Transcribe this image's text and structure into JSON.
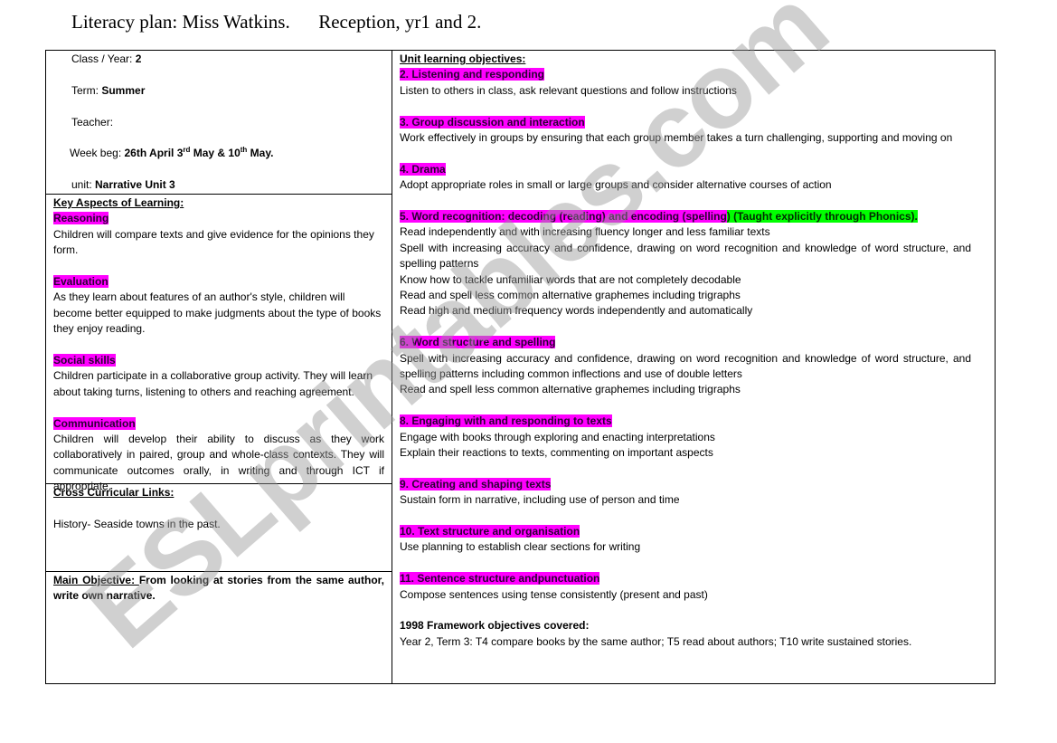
{
  "document": {
    "title": "Literacy plan: Miss Watkins.      Reception, yr1 and 2.",
    "watermark": "ESLprintables.com"
  },
  "header_info": {
    "class_year_label": "Class / Year: ",
    "class_year_value": "2",
    "term_label": "Term: ",
    "term_value": "Summer",
    "teacher_label": "Teacher:",
    "week_label": "Week beg: ",
    "week_part1": "26th April 3",
    "week_sup1": "rd",
    "week_part2": " May & 10",
    "week_sup2": "th",
    "week_part3": " May.",
    "unit_label": "unit: ",
    "unit_value": "Narrative Unit 3"
  },
  "key_aspects": {
    "heading": "Key Aspects of Learning:",
    "items": [
      {
        "label": "Reasoning",
        "text": "Children will compare texts and give evidence for the opinions they form."
      },
      {
        "label": "Evaluation",
        "text": "As they learn about features of an author's style, children will become better equipped to make judgments about the type of books they enjoy reading."
      },
      {
        "label": "Social skills",
        "text": "Children participate in a collaborative group activity.  They will learn about taking turns, listening to others and reaching agreement."
      },
      {
        "label": "Communication",
        "text": "Children will develop their ability to discuss as they work collaboratively in paired, group and whole-class contexts. They will communicate outcomes orally, in writing and through ICT if appropriate."
      }
    ]
  },
  "cross_curricular": {
    "heading": "Cross Curricular Links:",
    "text": "History- Seaside towns in the past."
  },
  "main_objective": {
    "label": "Main Objective: ",
    "text": " From looking at stories from the same author, write own narrative."
  },
  "unit_objectives": {
    "heading": "Unit learning objectives:",
    "items": [
      {
        "label": "2. Listening and responding",
        "lines": [
          "Listen to others in class, ask relevant questions and follow instructions"
        ]
      },
      {
        "label": "3. Group discussion and interaction",
        "lines": [
          "Work effectively in groups by ensuring that each group member takes a turn challenging, supporting and moving on"
        ]
      },
      {
        "label": "4. Drama",
        "lines": [
          "Adopt appropriate roles in small or large groups and consider alternative courses of action"
        ]
      },
      {
        "label": "5. Word recognition: decoding (reading) and encoding (spelling",
        "label_extra": ") (Taught explicitly through Phonics).",
        "lines": [
          "Read independently and with increasing fluency longer and less familiar texts",
          "Spell with increasing accuracy and confidence, drawing on word recognition and knowledge of word structure, and spelling patterns",
          "Know how to tackle unfamiliar words that are not completely decodable",
          "Read and spell less common alternative graphemes including trigraphs",
          "Read high and medium frequency words independently and automatically"
        ]
      },
      {
        "label": "6. Word structure and spelling",
        "lines": [
          "Spell with increasing accuracy and confidence, drawing on word recognition and knowledge of word structure, and spelling patterns including common inflections and use of double letters",
          "Read and spell less common alternative graphemes including trigraphs"
        ]
      },
      {
        "label": "8. Engaging with and responding to texts",
        "lines": [
          "Engage with books through exploring and enacting interpretations",
          "Explain their reactions to texts, commenting on important aspects"
        ]
      },
      {
        "label": "9. Creating and shaping texts",
        "lines": [
          "Sustain form in narrative, including use of person and time"
        ]
      },
      {
        "label": "10. Text structure and organisation",
        "lines": [
          "Use planning to establish clear sections for writing"
        ]
      },
      {
        "label": "11. Sentence structure andpunctuation",
        "lines": [
          "Compose sentences using tense consistently (present and past)"
        ]
      }
    ],
    "framework_heading": "1998 Framework objectives covered:",
    "framework_text": "Year 2, Term 3: T4 compare books by the same author; T5 read about authors; T10 write sustained stories."
  },
  "colors": {
    "highlight_magenta": "#ff00ff",
    "highlight_green": "#00ff00"
  }
}
